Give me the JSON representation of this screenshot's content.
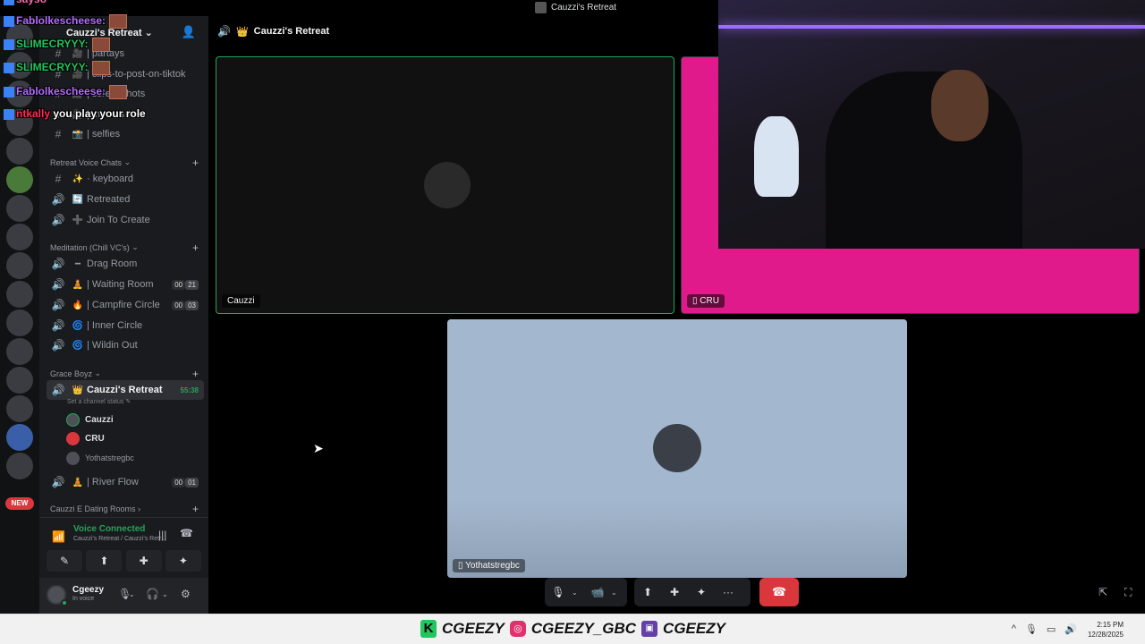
{
  "window": {
    "title": "Cauzzi's Retreat"
  },
  "server": {
    "name": "Cauzzi's Retreat",
    "chevron": "⌄"
  },
  "channels_top": [
    {
      "icon": "#",
      "emoji": "🎥",
      "label": "| partays"
    },
    {
      "icon": "#",
      "emoji": "🎥",
      "label": "| clips-to-post-on-tiktok"
    },
    {
      "icon": "#",
      "emoji": "🎥",
      "label": "| screenshots"
    },
    {
      "icon": "#",
      "emoji": "🎥",
      "label": "| memes"
    },
    {
      "icon": "#",
      "emoji": "📸",
      "label": "| selfies"
    }
  ],
  "cat_retreat": {
    "label": "Retreat Voice Chats",
    "plus": "+"
  },
  "channels_retreat": [
    {
      "icon": "#",
      "emoji": "✨",
      "label": "· keyboard"
    },
    {
      "icon": "🔊",
      "emoji": "🔄",
      "label": "Retreated"
    },
    {
      "icon": "🔊",
      "emoji": "➕",
      "label": "Join To Create"
    }
  ],
  "cat_meditation": {
    "label": "Meditation (Chill VC's)",
    "plus": "+"
  },
  "channels_meditation": [
    {
      "icon": "🔊",
      "emoji": "━",
      "label": "Drag Room"
    },
    {
      "icon": "🔊",
      "emoji": "🧘",
      "label": "| Waiting Room",
      "a": "00",
      "b": "21"
    },
    {
      "icon": "🔊",
      "emoji": "🔥",
      "label": "| Campfire Circle",
      "a": "00",
      "b": "03"
    },
    {
      "icon": "🔊",
      "emoji": "🌀",
      "label": "| Inner Circle"
    },
    {
      "icon": "🔊",
      "emoji": "🌀",
      "label": "| Wildin Out"
    }
  ],
  "cat_grace": {
    "label": "Grace Boyz",
    "plus": "+"
  },
  "active_channel": {
    "icon": "🔊",
    "emoji": "👑",
    "label": "Cauzzi's Retreat",
    "timer": "55:38",
    "status": "Set a channel status ✎"
  },
  "voice_users": [
    {
      "name": "Cauzzi"
    },
    {
      "name": "CRU"
    },
    {
      "name": "Yothatstregbc"
    }
  ],
  "river": {
    "icon": "🔊",
    "emoji": "🧘",
    "label": "| River Flow",
    "a": "00",
    "b": "01"
  },
  "cat_dating": {
    "label": "Cauzzi E Dating Rooms",
    "plus": "+"
  },
  "voice_panel": {
    "status": "Voice Connected",
    "sub": "Cauzzi's Retreat / Cauzzi's Retr...",
    "signal_icon": "signal-icon",
    "wave": "|||",
    "hang": "☎"
  },
  "voice_buttons": [
    "✎",
    "⬆",
    "✚",
    "✦"
  ],
  "user": {
    "name": "Cgeezy",
    "status": "In voice",
    "mic": "🎙",
    "headset": "🎧",
    "gear": "⚙"
  },
  "rail": {
    "new_label": "NEW"
  },
  "chat": [
    {
      "user": "sayso",
      "text": "",
      "color": "#ff69b4"
    },
    {
      "user": "Fablolkescheese:",
      "text": "",
      "color": "#b36bff"
    },
    {
      "user": "SLIMECRYYY:",
      "text": "",
      "color": "#22c55e"
    },
    {
      "user": "SLIMECRYYY:",
      "text": "",
      "color": "#22c55e"
    },
    {
      "user": "Fablolkescheese:",
      "text": "",
      "color": "#b36bff"
    },
    {
      "user": "ntkally",
      "text": "you play your role",
      "color": "#ff2d55"
    }
  ],
  "main_header": {
    "speaker": "🔊",
    "emoji": "👑",
    "title": "Cauzzi's Retreat"
  },
  "tiles": {
    "cauzzi": {
      "name": "Cauzzi"
    },
    "cru": {
      "name": "CRU"
    },
    "yot": {
      "name": "Yothatstregbc"
    }
  },
  "controls": {
    "mic": "🎙",
    "video": "📹",
    "share": "⬆",
    "activity": "✚",
    "soundboard": "✦",
    "more": "···",
    "end": "☎",
    "chev": "⌄"
  },
  "taskbar": {
    "brand1": "CGEEZY",
    "brand2": "CGEEZY_GBC",
    "brand3": "CGEEZY",
    "time": "2:15 PM",
    "date": "12/28/2025"
  },
  "colors": {
    "accent_green": "#23a55a",
    "cru_tile": "#e01a8a",
    "yot_tile": "#a3b7ce",
    "end_call": "#da373c"
  }
}
